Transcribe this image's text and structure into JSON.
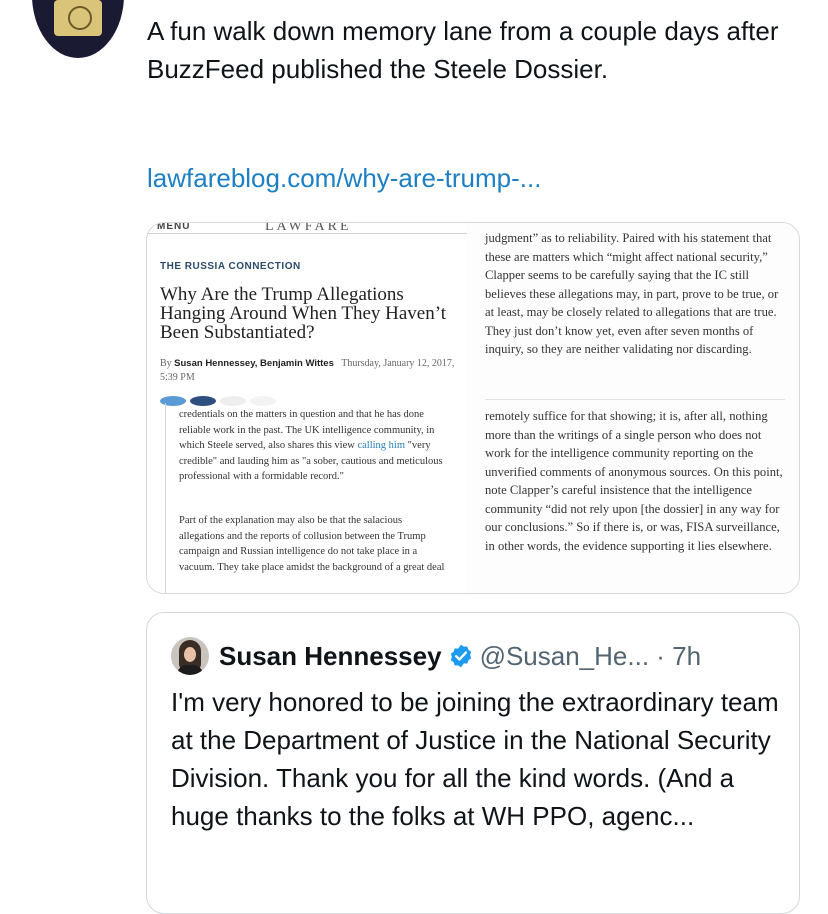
{
  "tweet": {
    "text": "A fun walk down memory lane from a couple days after BuzzFeed published the Steele Dossier.",
    "link_text": "lawfareblog.com/why-are-trump-..."
  },
  "article": {
    "masthead_menu": "MENU",
    "masthead_brand": "LAWFARE",
    "kicker": "THE RUSSIA CONNECTION",
    "headline": "Why Are the Trump Allegations Hanging Around When They Haven’t Been Substantiated?",
    "byline_prefix": "By",
    "authors": "Susan Hennessey, Benjamin Wittes",
    "date": "Thursday, January 12, 2017, 5:39 PM",
    "left_p1_a": "credentials on the matters in question and that he has done reliable work in the past. The UK intelligence community, in which Steele served, also shares this view ",
    "left_p1_link": "calling him",
    "left_p1_b": " \"very credible\" and lauding him as \"a sober, cautious and meticulous professional with a formidable record.\"",
    "left_p2": "Part of the explanation may also be that the salacious allegations and the reports of collusion between the Trump campaign and Russian intelligence do not take place in a vacuum. They take place amidst the background of a great deal",
    "right_p1": "judgment” as to reliability. Paired with his statement that these are matters which “might affect national security,” Clapper seems to be carefully saying that the IC still believes these allegations may, in part, prove to be true, or at least, may be closely related to allegations that are true. They just don’t know yet, even after seven months of inquiry, so they are neither validating nor discarding.",
    "right_p2": "remotely suffice for that showing; it is, after all, nothing more than the writings of a single person who does not work for the intelligence community reporting on the unverified comments of anonymous sources. On this point, note Clapper’s careful insistence that the intelligence community “did not rely upon [the dossier] in any way for our conclusions.” So if there is, or was, FISA surveillance, in other words, the evidence supporting it lies elsewhere."
  },
  "quoted_tweet": {
    "name": "Susan Hennessey",
    "handle": "@Susan_He...",
    "time": "· 7h",
    "text": "I'm very honored to be joining the extraordinary team at the Department of Justice in the National Security Division. Thank you for all the kind words. (And a huge thanks to the folks at WH PPO, agenc..."
  },
  "colors": {
    "link": "#1d7fc4",
    "verified": "#1d9bf0",
    "handle": "#536471"
  },
  "icons": [
    "avatar",
    "verified-badge-icon"
  ]
}
